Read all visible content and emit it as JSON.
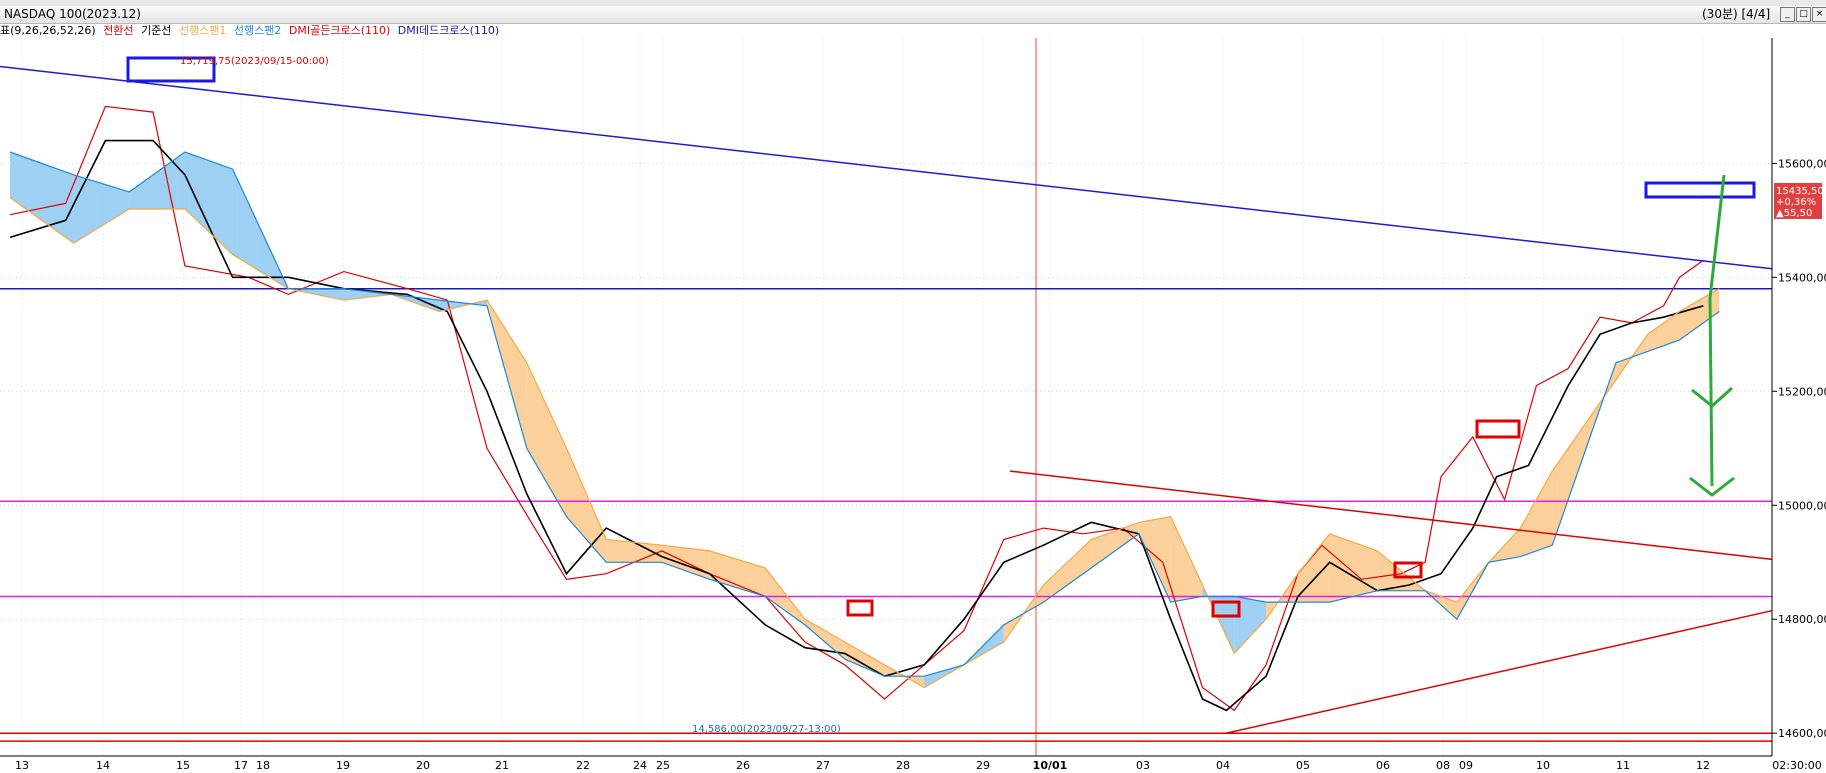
{
  "window": {
    "title": "NASDAQ 100(2023.12)",
    "period": "(30분) [4/4]",
    "buttons": [
      "_",
      "□",
      "×"
    ]
  },
  "legend": {
    "prefix": "표(9,26,26,52,26)",
    "items": [
      {
        "label": "전환선",
        "color": "#e00000"
      },
      {
        "label": "기준선",
        "color": "#000000"
      },
      {
        "label": "선행스팬1",
        "color": "#f5a84a"
      },
      {
        "label": "선행스팬2",
        "color": "#1e88d8"
      },
      {
        "label": "DMI골든크로스(110)",
        "color": "#e00000"
      },
      {
        "label": "DMI데드크로스(110)",
        "color": "#1a1aa8"
      }
    ]
  },
  "chart_data": {
    "type": "line",
    "x_labels": [
      "13",
      "14",
      "15",
      "17",
      "18",
      "19",
      "20",
      "21",
      "22",
      "24",
      "25",
      "26",
      "27",
      "28",
      "29",
      "10/01",
      "03",
      "04",
      "05",
      "06",
      "08",
      "09",
      "10",
      "11",
      "12",
      "02:30:00"
    ],
    "y_ticks": [
      14600,
      14800,
      15000,
      15200,
      15400,
      15600
    ],
    "y_tick_labels": [
      "14600,00",
      "14800,00",
      "15000,00",
      "15200,00",
      "15400,00",
      "15600,00"
    ],
    "ylim": [
      14560,
      15820
    ],
    "annotations": {
      "high_label": "15,719,75(2023/09/15-00:00)",
      "low_label": "14,586,00(2023/09/27-13:00)"
    },
    "current_price": {
      "value": "15435,50",
      "change_pct": "+0,36%",
      "change": "▲55,50"
    },
    "horizontal_lines": [
      {
        "y": 15380,
        "color": "#1a1aa8"
      },
      {
        "y": 15007,
        "color": "#e020e0"
      },
      {
        "y": 14840,
        "color": "#e020e0"
      },
      {
        "y": 14600,
        "color": "#e00000"
      },
      {
        "y": 14586,
        "color": "#e00000"
      }
    ],
    "series": [
      {
        "name": "전환선",
        "color": "#e00000",
        "values": [
          [
            0,
            15510
          ],
          [
            0.7,
            15530
          ],
          [
            1.2,
            15700
          ],
          [
            1.8,
            15690
          ],
          [
            2.2,
            15420
          ],
          [
            3,
            15400
          ],
          [
            3.5,
            15370
          ],
          [
            4.2,
            15410
          ],
          [
            5,
            15380
          ],
          [
            5.5,
            15360
          ],
          [
            6,
            15100
          ],
          [
            6.6,
            14960
          ],
          [
            7,
            14870
          ],
          [
            7.5,
            14880
          ],
          [
            8.2,
            14920
          ],
          [
            8.8,
            14880
          ],
          [
            9.5,
            14840
          ],
          [
            10,
            14760
          ],
          [
            10.5,
            14720
          ],
          [
            11,
            14660
          ],
          [
            11.5,
            14720
          ],
          [
            12,
            14780
          ],
          [
            12.5,
            14940
          ],
          [
            13,
            14960
          ],
          [
            13.5,
            14950
          ],
          [
            14,
            14960
          ],
          [
            14.5,
            14900
          ],
          [
            15,
            14680
          ],
          [
            15.4,
            14640
          ],
          [
            15.8,
            14720
          ],
          [
            16.2,
            14880
          ],
          [
            16.5,
            14930
          ],
          [
            17,
            14870
          ],
          [
            17.5,
            14880
          ],
          [
            17.8,
            14900
          ],
          [
            18,
            15050
          ],
          [
            18.4,
            15120
          ],
          [
            18.8,
            15010
          ],
          [
            19.2,
            15210
          ],
          [
            19.6,
            15240
          ],
          [
            20,
            15330
          ],
          [
            20.4,
            15320
          ],
          [
            20.8,
            15350
          ],
          [
            21,
            15400
          ],
          [
            21.3,
            15430
          ]
        ]
      },
      {
        "name": "기준선",
        "color": "#000000",
        "values": [
          [
            0,
            15470
          ],
          [
            0.7,
            15500
          ],
          [
            1.2,
            15640
          ],
          [
            1.8,
            15640
          ],
          [
            2.2,
            15580
          ],
          [
            2.8,
            15400
          ],
          [
            3.5,
            15400
          ],
          [
            4.2,
            15380
          ],
          [
            5,
            15370
          ],
          [
            5.5,
            15340
          ],
          [
            6,
            15200
          ],
          [
            6.5,
            15020
          ],
          [
            7,
            14880
          ],
          [
            7.5,
            14960
          ],
          [
            8.2,
            14910
          ],
          [
            8.8,
            14880
          ],
          [
            9.5,
            14790
          ],
          [
            10,
            14750
          ],
          [
            10.5,
            14740
          ],
          [
            11,
            14700
          ],
          [
            11.5,
            14720
          ],
          [
            12,
            14800
          ],
          [
            12.5,
            14900
          ],
          [
            13,
            14930
          ],
          [
            13.6,
            14970
          ],
          [
            14.2,
            14950
          ],
          [
            14.6,
            14800
          ],
          [
            15,
            14660
          ],
          [
            15.3,
            14640
          ],
          [
            15.8,
            14700
          ],
          [
            16.2,
            14840
          ],
          [
            16.6,
            14900
          ],
          [
            17.2,
            14850
          ],
          [
            17.6,
            14860
          ],
          [
            18,
            14880
          ],
          [
            18.4,
            14960
          ],
          [
            18.7,
            15050
          ],
          [
            19.1,
            15070
          ],
          [
            19.6,
            15210
          ],
          [
            20,
            15300
          ],
          [
            20.4,
            15320
          ],
          [
            20.8,
            15330
          ],
          [
            21.3,
            15350
          ]
        ]
      },
      {
        "name": "선행스팬1",
        "color": "#f5a84a",
        "values": [
          [
            0,
            15540
          ],
          [
            0.8,
            15460
          ],
          [
            1.5,
            15520
          ],
          [
            2.2,
            15520
          ],
          [
            2.8,
            15440
          ],
          [
            3.5,
            15380
          ],
          [
            4.2,
            15360
          ],
          [
            4.8,
            15370
          ],
          [
            5.4,
            15340
          ],
          [
            6,
            15360
          ],
          [
            6.5,
            15250
          ],
          [
            7,
            15100
          ],
          [
            7.5,
            14940
          ],
          [
            8.2,
            14930
          ],
          [
            8.8,
            14920
          ],
          [
            9.5,
            14890
          ],
          [
            10,
            14800
          ],
          [
            10.5,
            14760
          ],
          [
            11,
            14720
          ],
          [
            11.5,
            14680
          ],
          [
            12,
            14720
          ],
          [
            12.5,
            14760
          ],
          [
            13,
            14860
          ],
          [
            13.6,
            14940
          ],
          [
            14.2,
            14970
          ],
          [
            14.6,
            14980
          ],
          [
            15,
            14860
          ],
          [
            15.4,
            14740
          ],
          [
            15.8,
            14800
          ],
          [
            16.2,
            14880
          ],
          [
            16.6,
            14950
          ],
          [
            17.2,
            14920
          ],
          [
            17.8,
            14850
          ],
          [
            18.2,
            14830
          ],
          [
            18.6,
            14900
          ],
          [
            19,
            14960
          ],
          [
            19.4,
            15060
          ],
          [
            19.8,
            15140
          ],
          [
            20.2,
            15220
          ],
          [
            20.6,
            15300
          ],
          [
            21,
            15340
          ],
          [
            21.5,
            15380
          ]
        ]
      },
      {
        "name": "선행스팬2",
        "color": "#1e88d8",
        "values": [
          [
            0,
            15620
          ],
          [
            0.8,
            15580
          ],
          [
            1.5,
            15550
          ],
          [
            2.2,
            15620
          ],
          [
            2.8,
            15590
          ],
          [
            3.5,
            15380
          ],
          [
            4.2,
            15380
          ],
          [
            4.8,
            15370
          ],
          [
            5.4,
            15360
          ],
          [
            6,
            15350
          ],
          [
            6.5,
            15100
          ],
          [
            7,
            14980
          ],
          [
            7.5,
            14900
          ],
          [
            8.2,
            14900
          ],
          [
            8.8,
            14870
          ],
          [
            9.5,
            14840
          ],
          [
            10,
            14790
          ],
          [
            10.5,
            14730
          ],
          [
            11,
            14700
          ],
          [
            11.5,
            14700
          ],
          [
            12,
            14720
          ],
          [
            12.5,
            14790
          ],
          [
            13,
            14830
          ],
          [
            13.6,
            14890
          ],
          [
            14.2,
            14950
          ],
          [
            14.6,
            14830
          ],
          [
            15,
            14840
          ],
          [
            15.4,
            14840
          ],
          [
            15.8,
            14830
          ],
          [
            16.2,
            14830
          ],
          [
            16.6,
            14830
          ],
          [
            17.2,
            14850
          ],
          [
            17.8,
            14850
          ],
          [
            18.2,
            14800
          ],
          [
            18.6,
            14900
          ],
          [
            19,
            14910
          ],
          [
            19.4,
            14930
          ],
          [
            19.8,
            15090
          ],
          [
            20.2,
            15250
          ],
          [
            20.6,
            15270
          ],
          [
            21,
            15290
          ],
          [
            21.5,
            15340
          ]
        ]
      }
    ]
  }
}
